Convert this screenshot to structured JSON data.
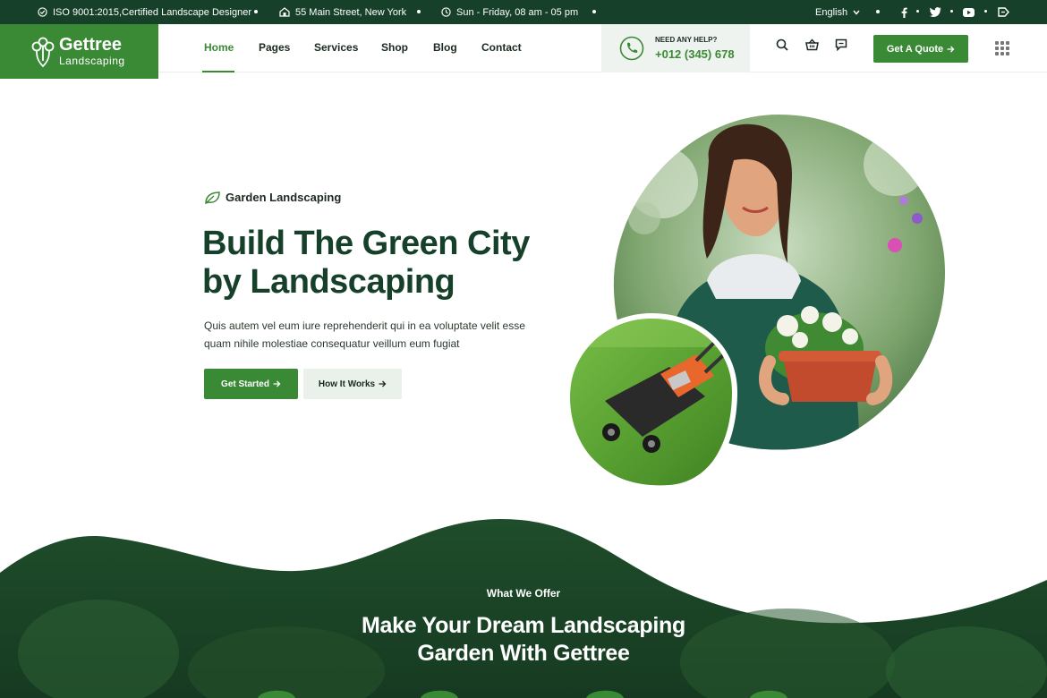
{
  "topbar": {
    "certification": "ISO 9001:2015,Certified Landscape Designer",
    "address": "55 Main Street, New York",
    "hours": "Sun - Friday, 08 am - 05 pm",
    "language": "English",
    "social": [
      "facebook-icon",
      "twitter-icon",
      "youtube-icon",
      "tag-icon"
    ]
  },
  "logo": {
    "title": "Gettree",
    "subtitle": "Landscaping"
  },
  "nav": {
    "items": [
      "Home",
      "Pages",
      "Services",
      "Shop",
      "Blog",
      "Contact"
    ],
    "active": "Home"
  },
  "help": {
    "label": "NEED ANY HELP?",
    "phone": "+012 (345) 678"
  },
  "header_icons": [
    "search-icon",
    "basket-icon",
    "chat-icon"
  ],
  "quote_button": {
    "label": "Get A Quote"
  },
  "hero": {
    "tag": "Garden Landscaping",
    "title_line1": "Build The Green City",
    "title_line2": "by Landscaping",
    "desc_line1": "Quis autem vel eum iure reprehenderit qui in ea voluptate velit esse",
    "desc_line2": "quam nihile molestiae consequatur veillum eum fugiat",
    "primary_button": "Get Started",
    "secondary_button": "How It Works"
  },
  "offer": {
    "label": "What We Offer",
    "title_line1": "Make Your Dream Landscaping",
    "title_line2": "Garden With Gettree"
  },
  "colors": {
    "brand_green": "#3a8a35",
    "dark_green": "#17402a",
    "light_bg": "#eff3ef"
  }
}
